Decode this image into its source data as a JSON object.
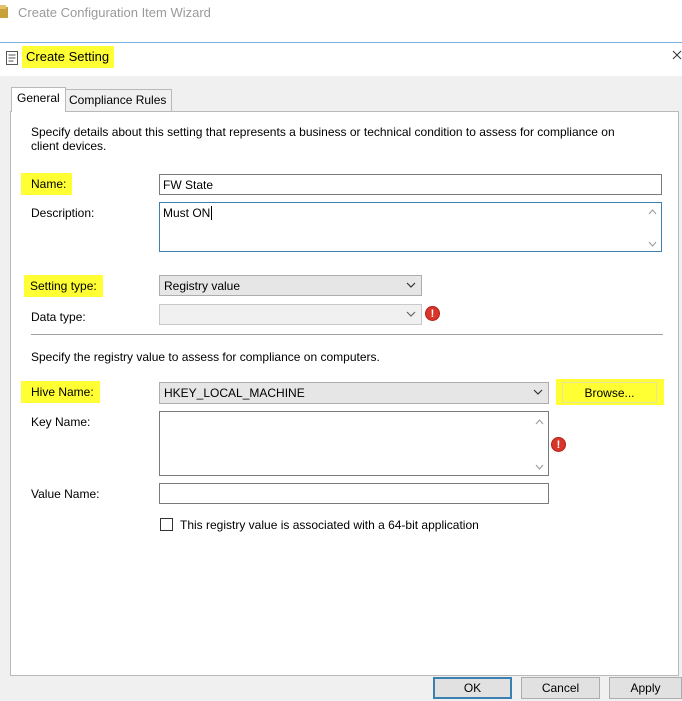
{
  "outer_window": {
    "title": "Create Configuration Item Wizard"
  },
  "dialog": {
    "title": "Create Setting",
    "tabs": [
      {
        "label": "General",
        "active": true
      },
      {
        "label": "Compliance Rules",
        "active": false
      }
    ],
    "intro": "Specify details about this setting that represents a business or technical condition to assess for compliance on client devices.",
    "name": {
      "label": "Name:",
      "value": "FW State"
    },
    "description": {
      "label": "Description:",
      "value": "Must ON"
    },
    "setting_type": {
      "label": "Setting type:",
      "value": "Registry value"
    },
    "data_type": {
      "label": "Data type:",
      "value": ""
    },
    "registry_intro": "Specify the registry value to assess for compliance on computers.",
    "hive": {
      "label": "Hive Name:",
      "value": "HKEY_LOCAL_MACHINE",
      "browse_label": "Browse..."
    },
    "key_name": {
      "label": "Key Name:",
      "value": ""
    },
    "value_name": {
      "label": "Value Name:",
      "value": ""
    },
    "bit64": {
      "label": "This registry value is associated with a 64-bit application",
      "checked": false
    },
    "buttons": {
      "ok": "OK",
      "cancel": "Cancel",
      "apply": "Apply"
    }
  },
  "colors": {
    "highlight": "#ffff33",
    "focus_border": "#3c7fb1",
    "error": "#d8362a"
  }
}
